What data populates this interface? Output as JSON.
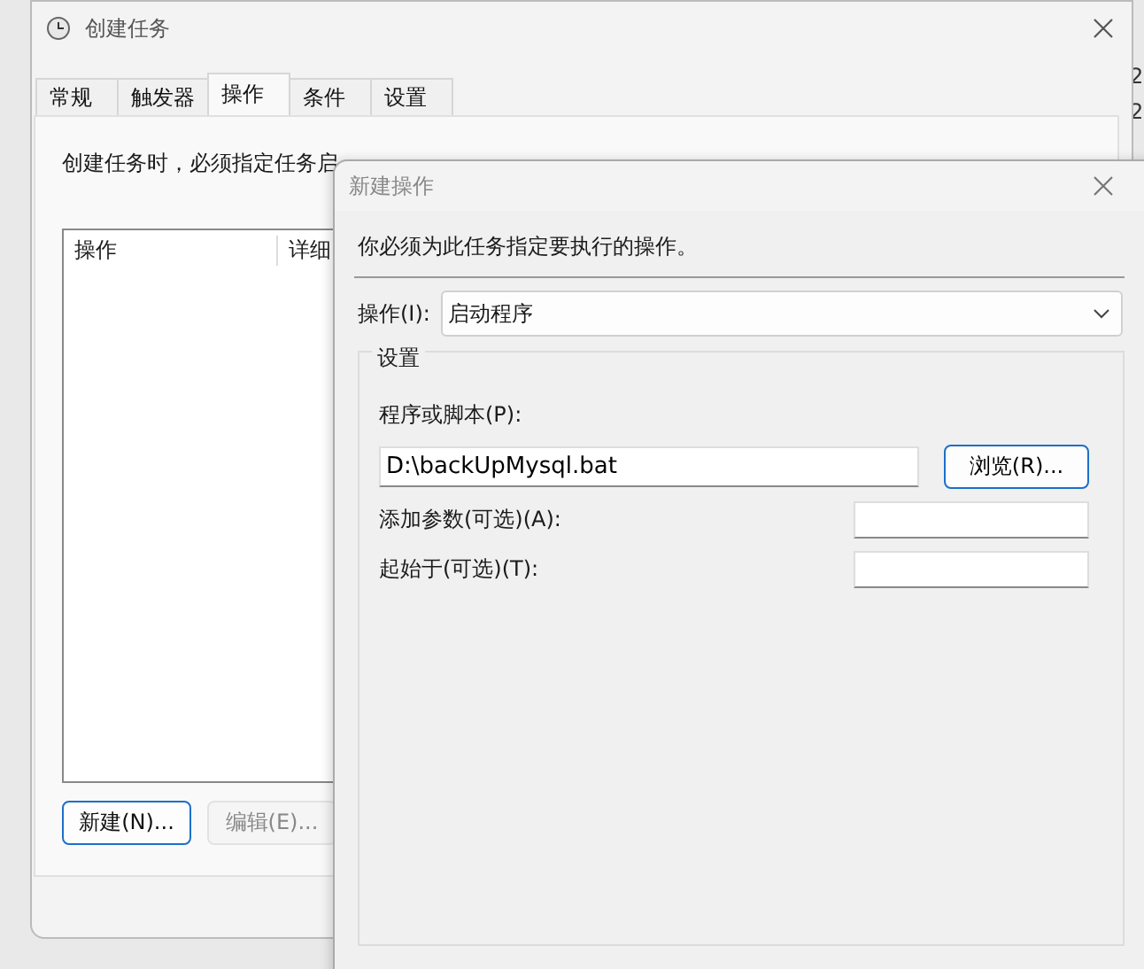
{
  "background": {
    "edge_texts": [
      "2",
      "2"
    ]
  },
  "window": {
    "title": "创建任务",
    "tabs": [
      {
        "label": "常规",
        "selected": false
      },
      {
        "label": "触发器",
        "selected": false
      },
      {
        "label": "操作",
        "selected": true
      },
      {
        "label": "条件",
        "selected": false
      },
      {
        "label": "设置",
        "selected": false
      }
    ],
    "description": "创建任务时，必须指定任务启",
    "table": {
      "columns": [
        "操作",
        "详细"
      ]
    },
    "buttons": [
      {
        "label": "新建(N)...",
        "disabled": false
      },
      {
        "label": "编辑(E)...",
        "disabled": true
      }
    ]
  },
  "dialog": {
    "title": "新建操作",
    "instruction": "你必须为此任务指定要执行的操作。",
    "action_label": "操作(I):",
    "action_value": "启动程序",
    "group_title": "设置",
    "program_label": "程序或脚本(P):",
    "program_value": "D:\\backUpMysql.bat",
    "browse_button": "浏览(R)...",
    "args_label": "添加参数(可选)(A):",
    "start_label": "起始于(可选)(T):"
  }
}
